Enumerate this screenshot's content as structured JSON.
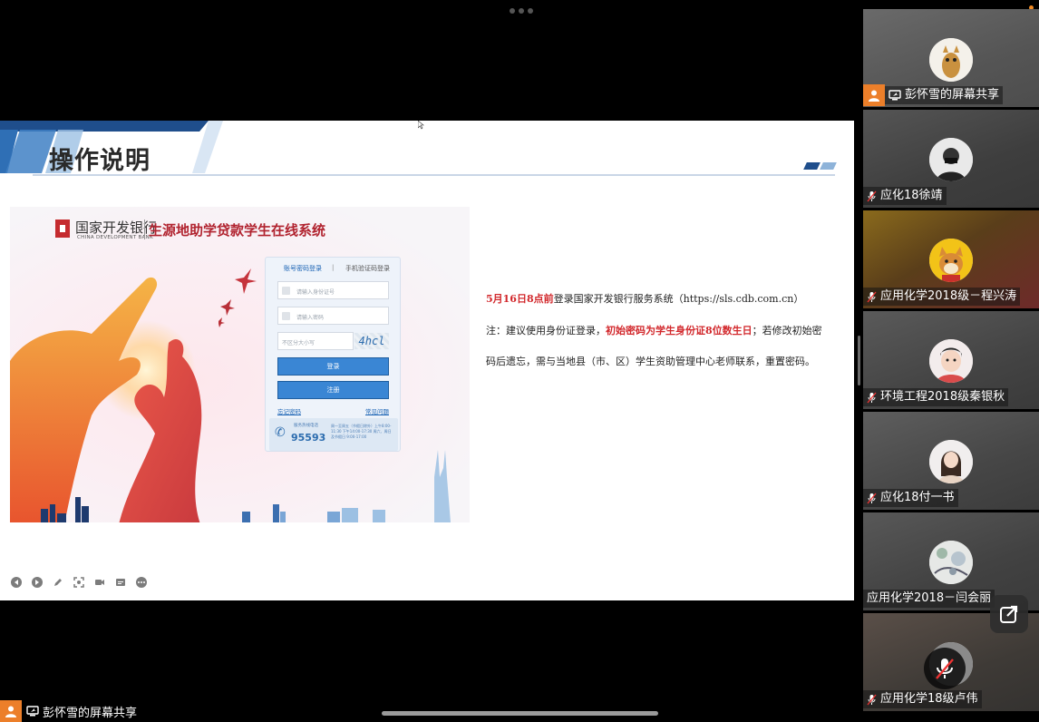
{
  "slide": {
    "title": "操作说明",
    "instructions": {
      "line1_red": "5月16日8点前",
      "line1_rest": "登录国家开发银行服务系统（https://sls.cdb.com.cn）",
      "line2_prefix": "注：建议使用身份证登录，",
      "line2_red": "初始密码为学生身份证8位数生日",
      "line2_rest": "；若修改初始密",
      "line3": "码后遗忘，需与当地县（市、区）学生资助管理中心老师联系，重置密码。"
    }
  },
  "bank_login": {
    "bank_name": "国家开发银行",
    "bank_name_en": "CHINA DEVELOPMENT BANK",
    "system_title": "生源地助学贷款学生在线系统",
    "tab_account": "账号密码登录",
    "tab_separator": "|",
    "tab_phone": "手机验证码登录",
    "id_placeholder": "请输入身份证号",
    "password_placeholder": "请输入密码",
    "captcha_placeholder": "不区分大小写",
    "captcha_text": "4hcl",
    "login_button": "登录",
    "register_button": "注册",
    "forgot_password": "忘记密码",
    "faq": "常见问题",
    "hotline_label": "服务热线电话",
    "hotline_number": "95593",
    "hotline_info": "周一至周五（节假日除外）上午8:00-11:30 下午14:00-17:30 周六、周日及节假日 9:00-17:00"
  },
  "participants": [
    {
      "name": "彭怀雪的屏幕共享",
      "type": "screen-share",
      "avatar": "cat-avatar"
    },
    {
      "name": "应化18徐靖",
      "type": "muted",
      "avatar": "masked-person-avatar"
    },
    {
      "name": "应用化学2018级－程兴涛",
      "type": "muted",
      "avatar": "shiba-dog-avatar"
    },
    {
      "name": "环境工程2018级秦银秋",
      "type": "muted",
      "avatar": "cartoon-boy-avatar"
    },
    {
      "name": "应化18付一书",
      "type": "muted",
      "avatar": "girl-photo-avatar"
    },
    {
      "name": "应用化学2018－闫会丽",
      "type": "plain",
      "avatar": "sketch-avatar"
    },
    {
      "name": "应用化学18级卢伟",
      "type": "muted",
      "avatar": "unknown-avatar"
    }
  ],
  "bottom_bar": {
    "share_label": "彭怀雪的屏幕共享"
  },
  "colors": {
    "accent_red": "#d2282c",
    "share_orange": "#ec7f2a",
    "login_blue": "#3a86d4",
    "title_navy": "#1f4e8c"
  }
}
